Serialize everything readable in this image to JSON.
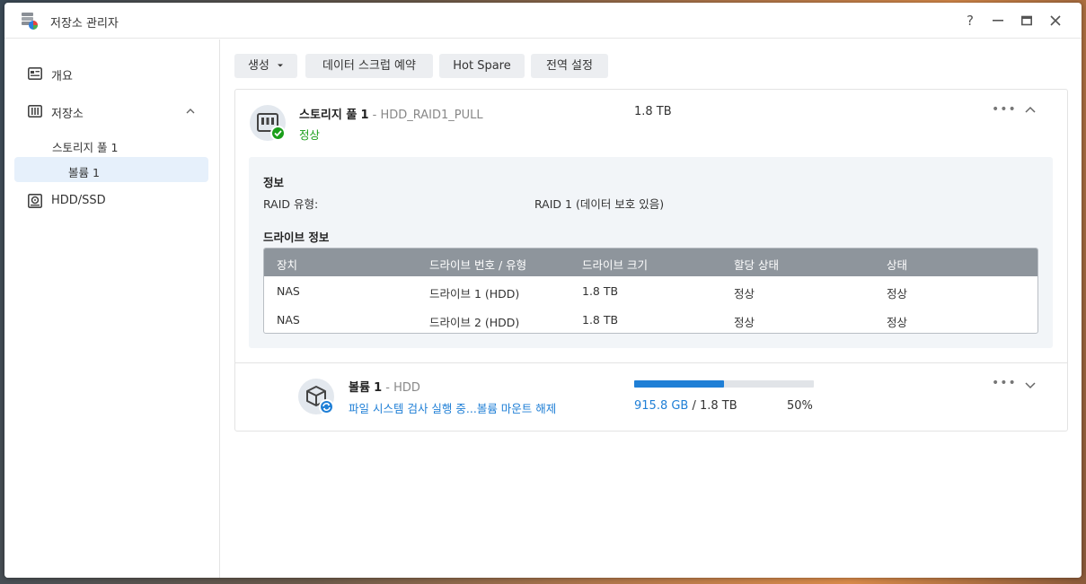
{
  "window": {
    "title": "저장소 관리자",
    "controls": [
      "?",
      "—",
      "□",
      "✕"
    ]
  },
  "colors": {
    "accent": "#1f7fd6",
    "ok": "#1a9e1a",
    "table_header": "#8e959c",
    "active_nav": "#e6f0fb"
  },
  "sidebar": {
    "overview": "개요",
    "storage": "저장소",
    "pool": "스토리지 풀 1",
    "volume": "볼륨 1",
    "hdd": "HDD/SSD"
  },
  "toolbar": {
    "create": "생성",
    "scrub": "데이터 스크럽 예약",
    "hotspare": "Hot Spare",
    "global": "전역 설정"
  },
  "pool": {
    "name": "스토리지 풀",
    "num": "1",
    "desc": "- HDD_RAID1_PULL",
    "size": "1.8 TB",
    "status": "정상",
    "info_title": "정보",
    "raid_label": "RAID 유형:",
    "raid_value": "RAID 1 (데이터 보호 있음)",
    "drive_title": "드라이브 정보",
    "table": {
      "headers": [
        "장치",
        "드라이브 번호 / 유형",
        "드라이브 크기",
        "할당 상태",
        "상태"
      ],
      "rows": [
        [
          "NAS",
          "드라이브 1 (HDD)",
          "1.8 TB",
          "정상",
          "정상"
        ],
        [
          "NAS",
          "드라이브 2 (HDD)",
          "1.8 TB",
          "정상",
          "정상"
        ]
      ]
    }
  },
  "volume": {
    "name": "볼륨",
    "num": "1",
    "desc": "- HDD",
    "status": "파일 시스템 검사 실행 중...볼륨 마운트 해제",
    "used": "915.8 GB",
    "total": "/ 1.8 TB",
    "percent": "50%",
    "usage_fraction": 0.5
  }
}
